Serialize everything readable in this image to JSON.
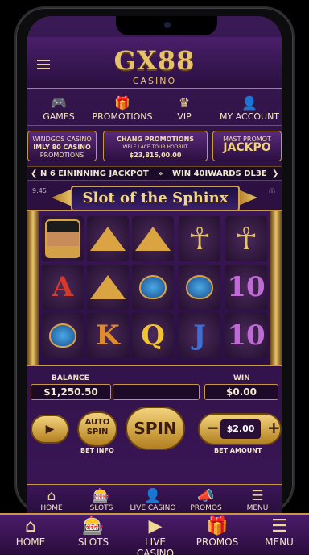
{
  "header": {
    "logo": "GX88",
    "logo_sub": "CASINO"
  },
  "top_nav": [
    {
      "label": "GAMES",
      "icon": "🎮"
    },
    {
      "label": "PROMOTIONS",
      "icon": "🎁"
    },
    {
      "label": "VIP",
      "icon": "♛"
    },
    {
      "label": "MY ACCOUNT",
      "icon": "👤"
    }
  ],
  "banners": {
    "left": {
      "line1": "WINDGOS CASINO",
      "line2": "IMLY 80 CASINO",
      "line3": "PROMOTIONS"
    },
    "center": {
      "line1": "CHANG PROMOTIONS",
      "line2": "WELE LACE TOUR HODBUT",
      "line3": "$23,815,00.00"
    },
    "right": {
      "line1": "MAST PROMOT",
      "line2": "JACKPO"
    }
  },
  "ticker": {
    "left_arrow": "❮",
    "text1": "N 6 EININNING JACKPOT",
    "sep": "»",
    "text2": "WIN 40IWARDS DL3E",
    "right_arrow": "❯"
  },
  "game": {
    "title": "Slot of the Sphinx",
    "corner_left": "9:45",
    "corner_right": "ⓘ"
  },
  "reels": {
    "row1": [
      "cleopatra",
      "pyramid",
      "pyramid",
      "ankh",
      "ankh"
    ],
    "row2": [
      "A",
      "pyramid",
      "scarab",
      "scarab",
      "10"
    ],
    "row3": [
      "scarab",
      "K",
      "Q",
      "J",
      "10"
    ]
  },
  "symbols": {
    "A": "A",
    "K": "K",
    "Q": "Q",
    "J": "J",
    "10": "10",
    "ankh": "☥"
  },
  "stats": {
    "balance_label": "BALANCE",
    "balance": "$1,250.50",
    "win_label": "WIN",
    "win": "$0.00"
  },
  "controls": {
    "auto_label": "AUTO SPIN",
    "spin_label": "SPIN",
    "bet_value": "$2.00",
    "minus": "−",
    "plus": "+",
    "bet_info_caption": "BET INFO",
    "bet_amount_caption": "BET AMOUNT",
    "play_icon": "▶"
  },
  "inner_nav": [
    {
      "label": "HOME",
      "icon": "⌂"
    },
    {
      "label": "SLOTS",
      "icon": "🎰"
    },
    {
      "label": "LIVE CASINO",
      "icon": "👤"
    },
    {
      "label": "PROMOS",
      "icon": "📣"
    },
    {
      "label": "MENU",
      "icon": "☰"
    }
  ],
  "bottom_nav": [
    {
      "label": "HOME",
      "icon": "⌂"
    },
    {
      "label": "SLOTS",
      "icon": "🎰"
    },
    {
      "label": "LIVE CASINO",
      "icon": "▶"
    },
    {
      "label": "PROMOS",
      "icon": "🎁"
    },
    {
      "label": "MENU",
      "icon": "☰"
    }
  ],
  "colors": {
    "gold": "#e6c36a",
    "purple": "#2a0f3f",
    "red_symbol": "#d33a2a",
    "blue_symbol": "#3a6fd6",
    "pink_symbol": "#c06ad6",
    "orange_symbol": "#e08a2a"
  }
}
